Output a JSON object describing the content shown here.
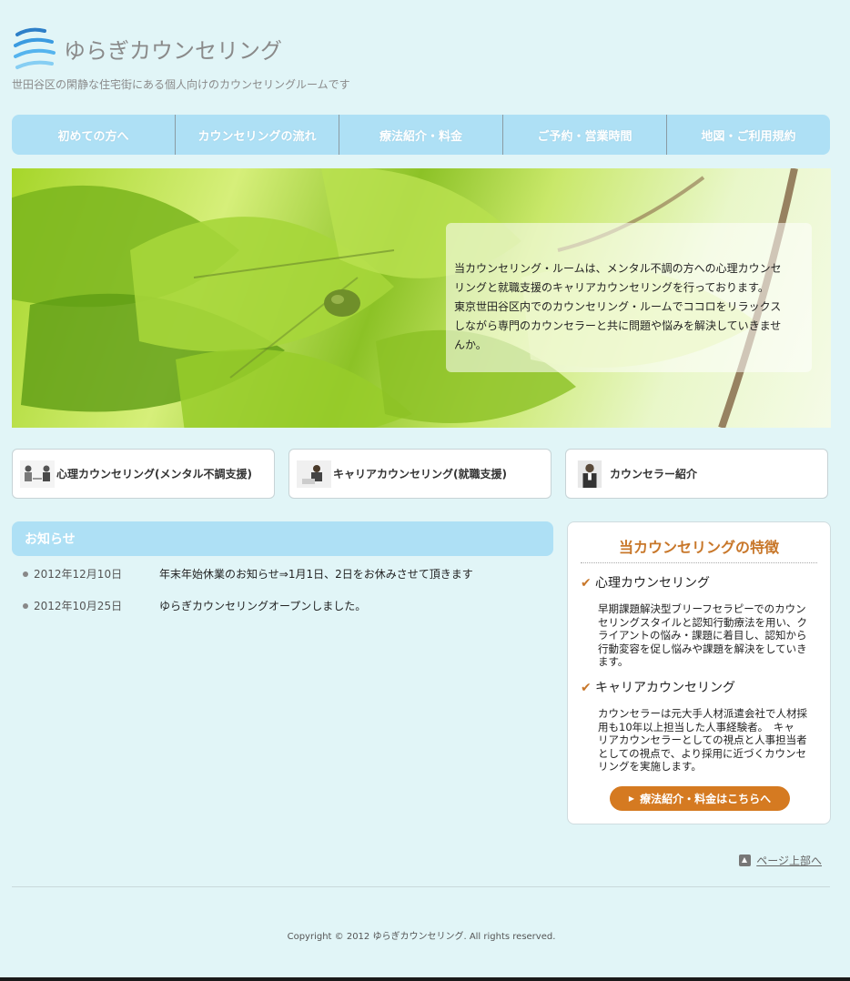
{
  "header": {
    "site_name": "ゆらぎカウンセリング",
    "tagline": "世田谷区の閑静な住宅街にある個人向けのカウンセリングルームです"
  },
  "nav": [
    {
      "label": "初めての方へ"
    },
    {
      "label": "カウンセリングの流れ"
    },
    {
      "label": "療法紹介・料金"
    },
    {
      "label": "ご予約・営業時間"
    },
    {
      "label": "地図・ご利用規約"
    }
  ],
  "hero": {
    "lines": [
      "当カウンセリング・ルームは、メンタル不調の方への心理カウンセ",
      "リングと就職支援のキャリアカウンセリングを行っております。",
      "東京世田谷区内でのカウンセリング・ルームでココロをリラックス",
      "しながら専門のカウンセラーと共に問題や悩みを解決していきませ",
      "んか。"
    ]
  },
  "services": [
    {
      "label": "心理カウンセリング(メンタル不調支援)"
    },
    {
      "label": "キャリアカウンセリング(就職支援)"
    },
    {
      "label": "カウンセラー紹介"
    }
  ],
  "news": {
    "title": "お知らせ",
    "items": [
      {
        "date": "2012年12月10日",
        "text": "年末年始休業のお知らせ⇒1月1日、2日をお休みさせて頂きます"
      },
      {
        "date": "2012年10月25日",
        "text": "ゆらぎカウンセリングオープンしました。"
      }
    ]
  },
  "features": {
    "title": "当カウンセリングの特徴",
    "items": [
      {
        "heading": "心理カウンセリング",
        "lines": [
          "早期課題解決型ブリーフセラピーでのカウン",
          "セリングスタイルと認知行動療法を用い、ク",
          "ライアントの悩み・課題に着目し、認知から",
          "行動変容を促し悩みや課題を解決をしていき",
          "ます。"
        ]
      },
      {
        "heading": "キャリアカウンセリング",
        "lines": [
          "カウンセラーは元大手人材派遣会社で人材採",
          "用も10年以上担当した人事経験者。　キャ",
          "リアカウンセラーとしての視点と人事担当者",
          "としての視点で、より採用に近づくカウンセ",
          "リングを実施します。"
        ]
      }
    ],
    "button": "療法紹介・料金はこちらへ"
  },
  "pagetop": "ページ上部へ",
  "footer": "Copyright © 2012 ゆらぎカウンセリング. All rights reserved.",
  "colors": {
    "background": "#e1f5f7",
    "nav": "#aee0f5",
    "accent": "#d57a21"
  }
}
